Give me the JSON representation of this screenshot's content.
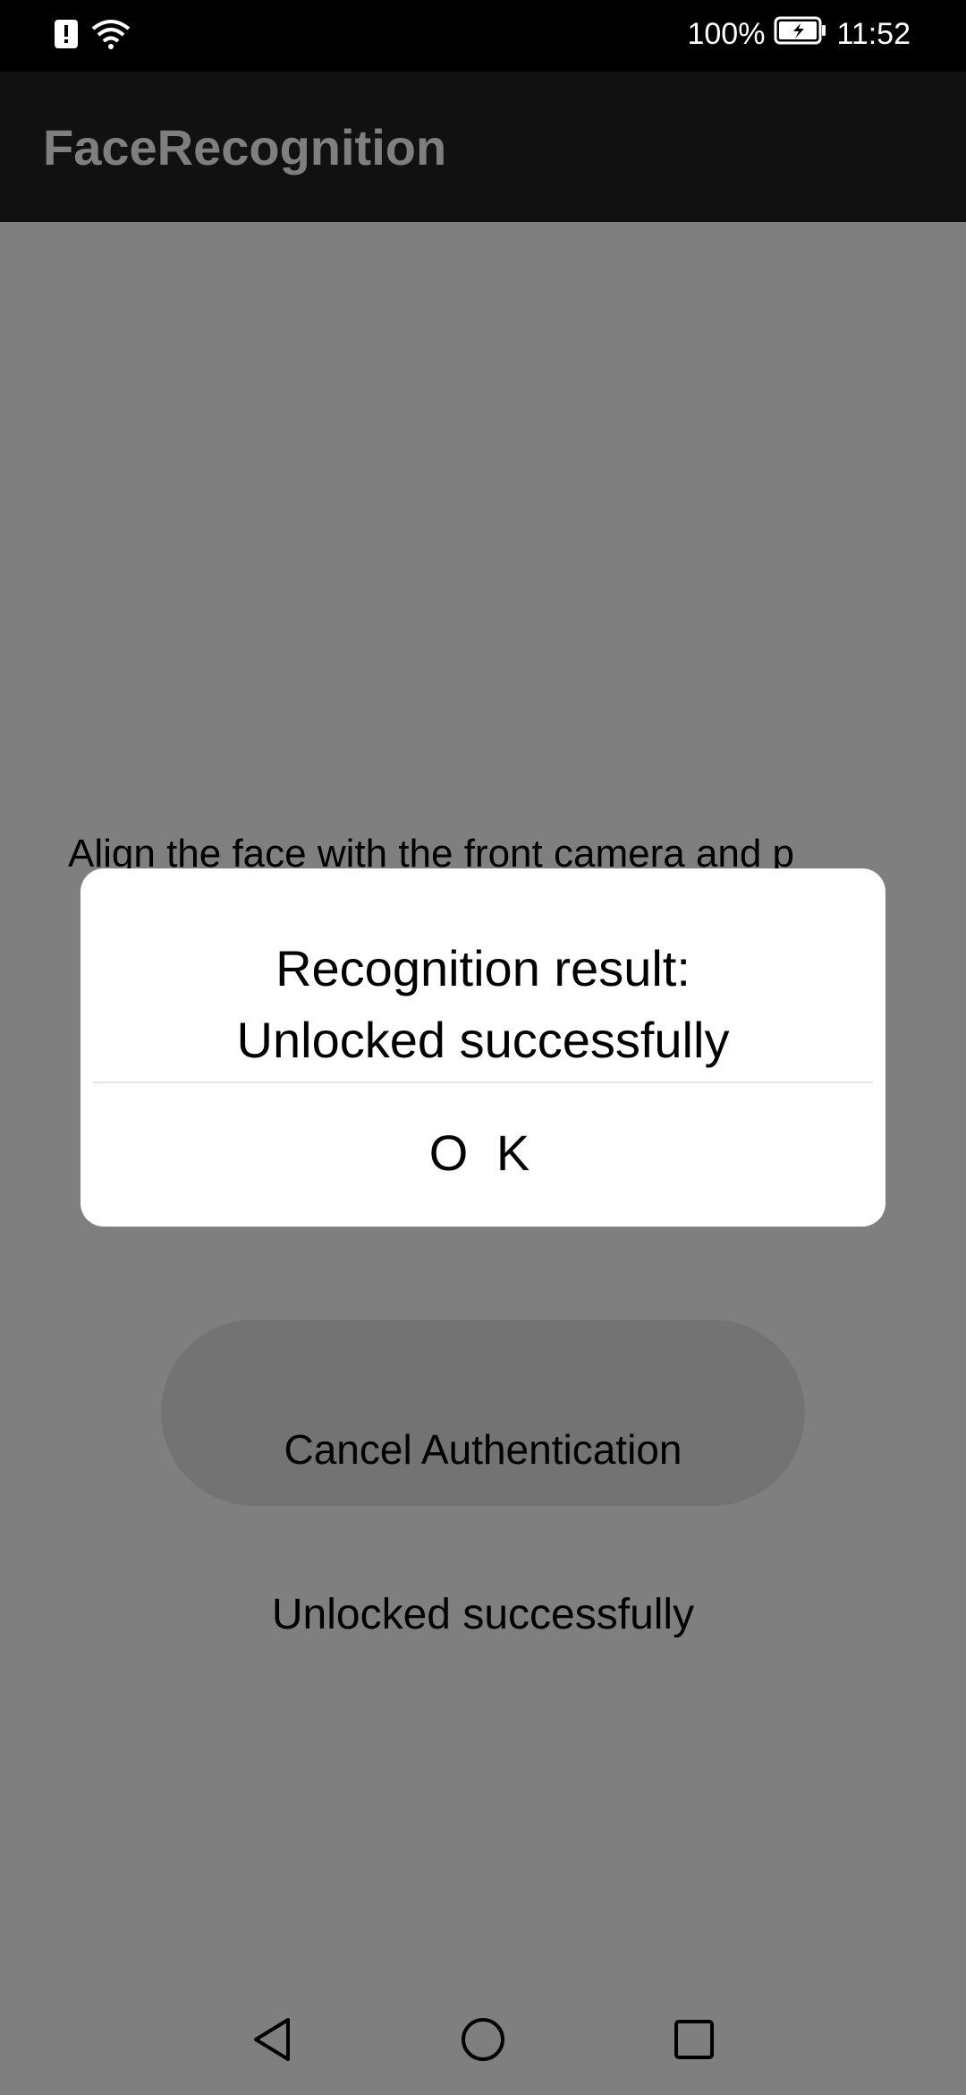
{
  "status_bar": {
    "battery_percent": "100%",
    "time": "11:52",
    "icons": [
      "alert-icon",
      "wifi-icon",
      "battery-charging-icon"
    ]
  },
  "app_bar": {
    "title": "FaceRecognition"
  },
  "main": {
    "instruction": "Align the face with the front camera and p",
    "cancel_button_label": "Cancel Authentication",
    "result_text": "Unlocked successfully"
  },
  "dialog": {
    "message_line1": "Recognition result:",
    "message_line2": "Unlocked successfully",
    "ok_label": "O K"
  },
  "nav_bar": {
    "icons": [
      "back-icon",
      "home-icon",
      "recents-icon"
    ]
  },
  "colors": {
    "status_bar_bg": "#000000",
    "app_bar_bg": "#222222",
    "scrim": "rgba(0,0,0,0.5)",
    "dialog_bg": "#ffffff"
  }
}
